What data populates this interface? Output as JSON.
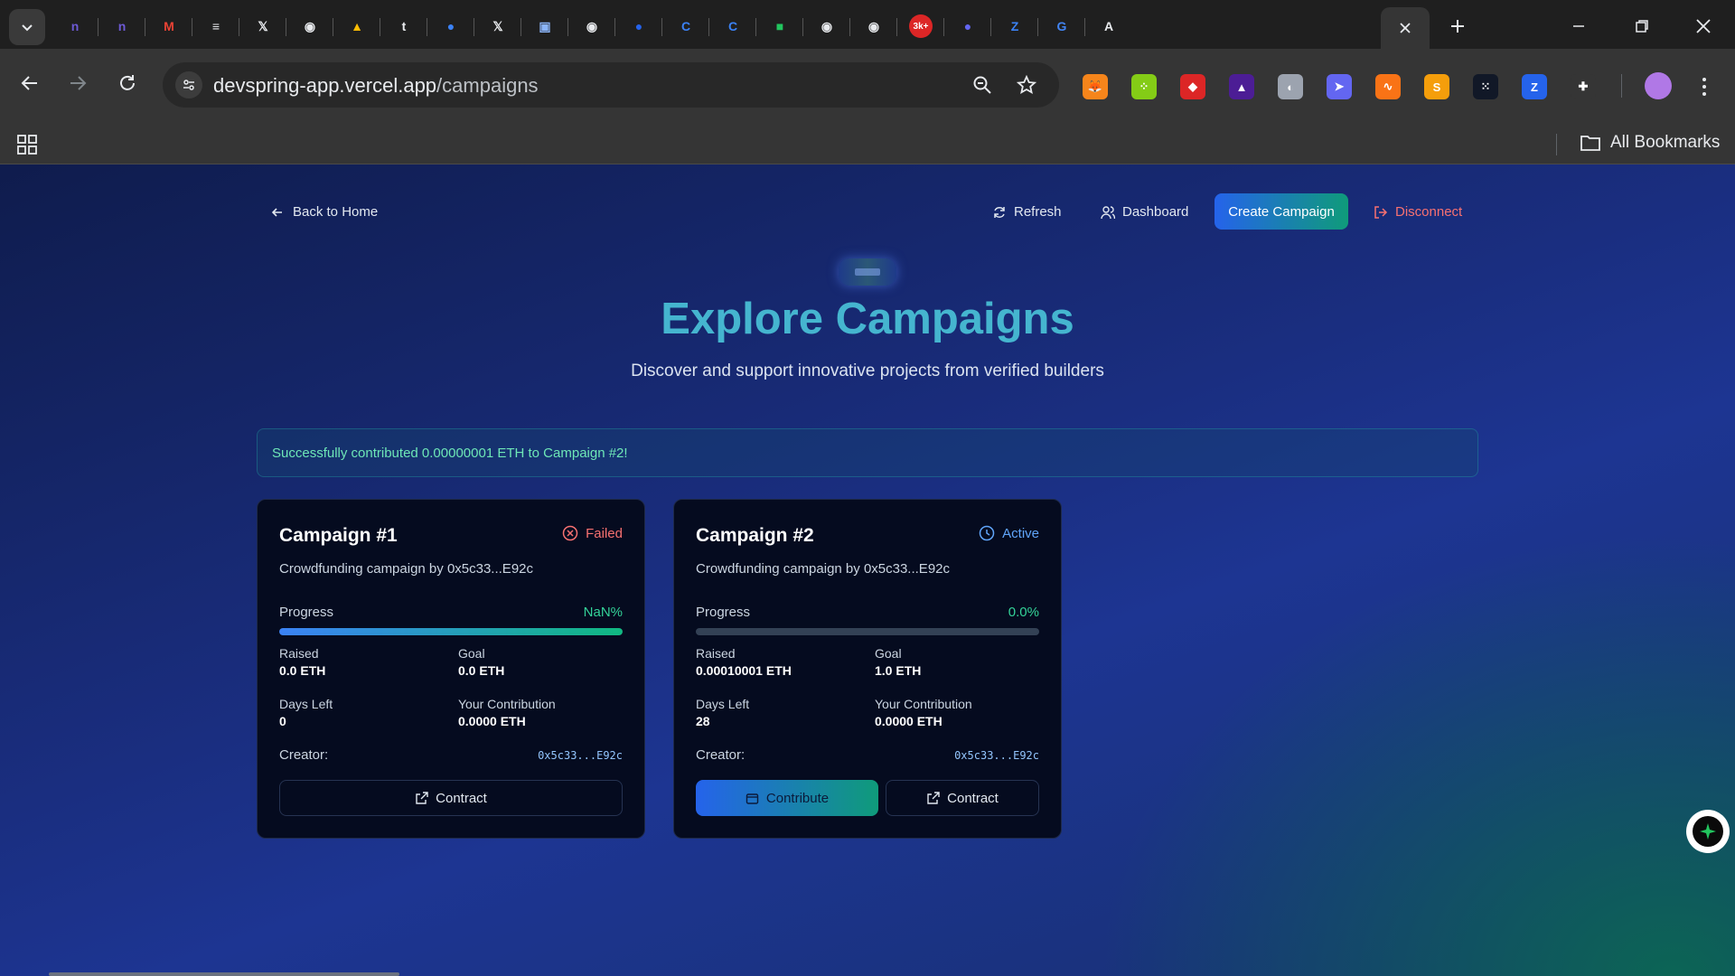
{
  "browser": {
    "tabs": [
      {
        "icon": "notion-style-icon",
        "color": "#6d5ad6",
        "glyph": "n"
      },
      {
        "icon": "notion-style-icon",
        "color": "#6d5ad6",
        "glyph": "n"
      },
      {
        "icon": "gmail-icon",
        "color": "#ea4335",
        "glyph": "M"
      },
      {
        "icon": "document-icon",
        "color": "#e8eaed",
        "glyph": "≡"
      },
      {
        "icon": "x-icon",
        "color": "#e8eaed",
        "glyph": "𝕏"
      },
      {
        "icon": "github-icon",
        "color": "#e8eaed",
        "glyph": "◉"
      },
      {
        "icon": "google-drive-icon",
        "color": "#fbbc04",
        "glyph": "▲"
      },
      {
        "icon": "tumblr-icon",
        "color": "#e8eaed",
        "glyph": "t"
      },
      {
        "icon": "blue-circle-icon",
        "color": "#3b82f6",
        "glyph": "●"
      },
      {
        "icon": "x-icon",
        "color": "#e8eaed",
        "glyph": "𝕏"
      },
      {
        "icon": "image-icon",
        "color": "#8ab4f8",
        "glyph": "▣"
      },
      {
        "icon": "github-icon",
        "color": "#e8eaed",
        "glyph": "◉"
      },
      {
        "icon": "blue-circle-icon",
        "color": "#2563eb",
        "glyph": "●"
      },
      {
        "icon": "c-circle-icon",
        "color": "#3b82f6",
        "glyph": "C"
      },
      {
        "icon": "c-circle-icon",
        "color": "#3b82f6",
        "glyph": "C"
      },
      {
        "icon": "green-square-icon",
        "color": "#22c55e",
        "glyph": "■"
      },
      {
        "icon": "github-icon",
        "color": "#e8eaed",
        "glyph": "◉"
      },
      {
        "icon": "github-icon",
        "color": "#e8eaed",
        "glyph": "◉"
      },
      {
        "icon": "badge-icon",
        "color": "#dc2626",
        "glyph": "3k+"
      },
      {
        "icon": "sphere-icon",
        "color": "#6366f1",
        "glyph": "●"
      },
      {
        "icon": "z-icon",
        "color": "#3b82f6",
        "glyph": "Z"
      },
      {
        "icon": "google-icon",
        "color": "#4285f4",
        "glyph": "G"
      },
      {
        "icon": "anthropic-icon",
        "color": "#e8eaed",
        "glyph": "A"
      }
    ],
    "url_host": "devspring-app.vercel.app",
    "url_path": "/campaigns",
    "all_bookmarks": "All Bookmarks",
    "extensions": [
      {
        "icon": "metamask-icon",
        "color": "#f6851b",
        "glyph": "🦊"
      },
      {
        "icon": "green-grid-icon",
        "color": "#84cc16",
        "glyph": "⁘"
      },
      {
        "icon": "red-square-icon",
        "color": "#dc2626",
        "glyph": "◆"
      },
      {
        "icon": "purple-drop-icon",
        "color": "#4c1d95",
        "glyph": "▲"
      },
      {
        "icon": "globe-icon",
        "color": "#9ca3af",
        "glyph": "◐"
      },
      {
        "icon": "wing-icon",
        "color": "#6366f1",
        "glyph": "➤"
      },
      {
        "icon": "wave-icon",
        "color": "#f97316",
        "glyph": "∿"
      },
      {
        "icon": "orange-s-icon",
        "color": "#f59e0b",
        "glyph": "S"
      },
      {
        "icon": "dots-icon",
        "color": "#111827",
        "glyph": "⁙"
      },
      {
        "icon": "blue-z-icon",
        "color": "#2563eb",
        "glyph": "Z"
      },
      {
        "icon": "puzzle-icon",
        "color": "#353535",
        "glyph": "✚"
      }
    ]
  },
  "nav": {
    "back": "Back to Home",
    "refresh": "Refresh",
    "dashboard": "Dashboard",
    "create": "Create Campaign",
    "disconnect": "Disconnect"
  },
  "hero": {
    "title": "Explore Campaigns",
    "subtitle": "Discover and support innovative projects from verified builders"
  },
  "alert": "Successfully contributed 0.00000001 ETH to Campaign #2!",
  "campaigns": [
    {
      "title": "Campaign #1",
      "status": "Failed",
      "status_color": "#f87171",
      "description": "Crowdfunding campaign by 0x5c33...E92c",
      "progress_label": "Progress",
      "progress_text": "NaN%",
      "progress_fill": 1.0,
      "raised_label": "Raised",
      "raised": "0.0 ETH",
      "goal_label": "Goal",
      "goal": "0.0 ETH",
      "days_label": "Days Left",
      "days": "0",
      "contrib_label": "Your Contribution",
      "contrib": "0.0000 ETH",
      "creator_label": "Creator:",
      "creator": "0x5c33...E92c",
      "contract_label": "Contract"
    },
    {
      "title": "Campaign #2",
      "status": "Active",
      "status_color": "#60a5fa",
      "description": "Crowdfunding campaign by 0x5c33...E92c",
      "progress_label": "Progress",
      "progress_text": "0.0%",
      "progress_fill": 0.0,
      "raised_label": "Raised",
      "raised": "0.00010001 ETH",
      "goal_label": "Goal",
      "goal": "1.0 ETH",
      "days_label": "Days Left",
      "days": "28",
      "contrib_label": "Your Contribution",
      "contrib": "0.0000 ETH",
      "creator_label": "Creator:",
      "creator": "0x5c33...E92c",
      "contribute_label": "Contribute",
      "contract_label": "Contract"
    }
  ]
}
